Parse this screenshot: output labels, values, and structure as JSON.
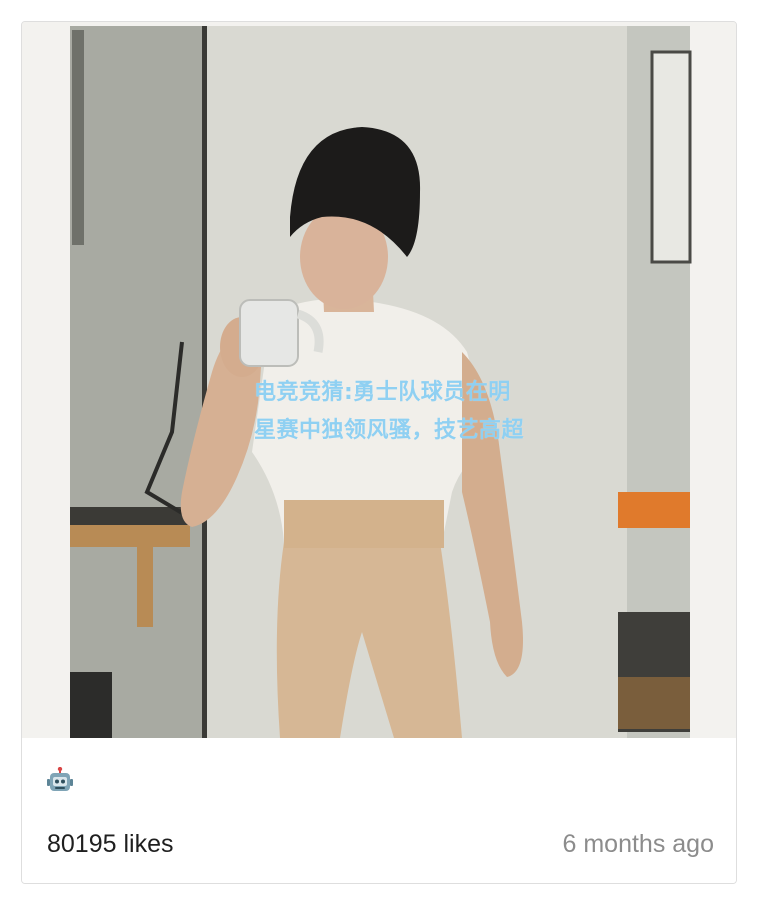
{
  "post": {
    "overlay_caption": "电竞竞猜:勇士队球员在明星赛中独领风骚，技艺高超",
    "icon": "robot-icon",
    "likes_text": "80195 likes",
    "time_text": "6 months ago"
  },
  "colors": {
    "caption_color": "#8fd0f2",
    "likes_color": "#1f1f1f",
    "time_color": "#8c8c8c",
    "card_border": "#dedede"
  }
}
